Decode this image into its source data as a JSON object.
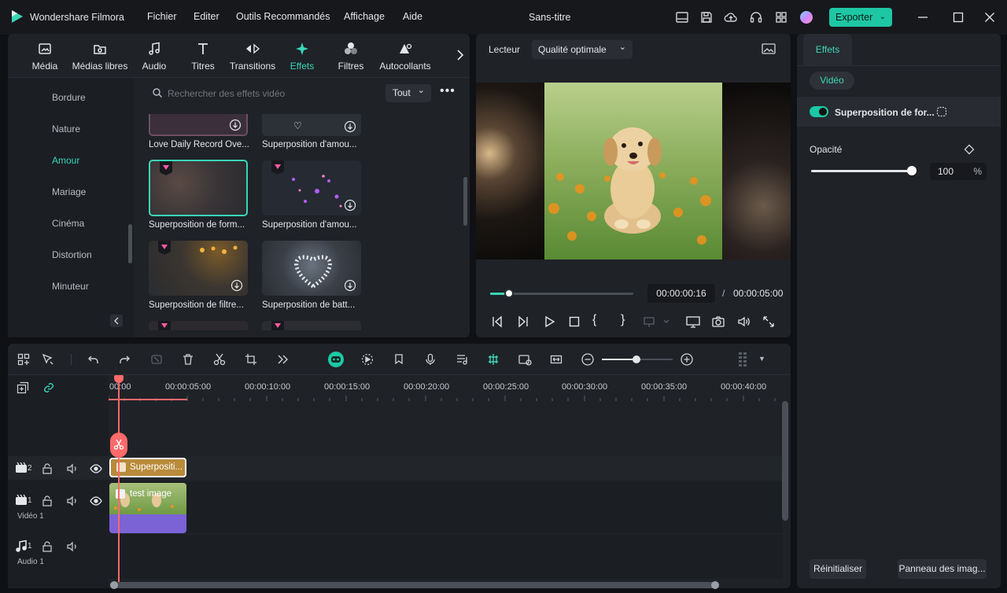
{
  "app": {
    "name": "Wondershare Filmora",
    "title": "Sans-titre",
    "export_label": "Exporter"
  },
  "menu": [
    "Fichier",
    "Editer",
    "Outils Recommandés",
    "Affichage",
    "Aide"
  ],
  "media_tabs": [
    {
      "label": "Média",
      "icon": "media-icon"
    },
    {
      "label": "Médias libres",
      "icon": "stock-media-icon"
    },
    {
      "label": "Audio",
      "icon": "music-note-icon"
    },
    {
      "label": "Titres",
      "icon": "text-t-icon"
    },
    {
      "label": "Transitions",
      "icon": "transition-icon"
    },
    {
      "label": "Effets",
      "icon": "sparkle-icon"
    },
    {
      "label": "Filtres",
      "icon": "filter-icon"
    },
    {
      "label": "Autocollants",
      "icon": "sticker-icon"
    }
  ],
  "categories": [
    "Bordure",
    "Nature",
    "Amour",
    "Mariage",
    "Cinéma",
    "Distortion",
    "Minuteur"
  ],
  "active_category": "Amour",
  "search": {
    "placeholder": "Rechercher des effets vidéo",
    "filter": "Tout"
  },
  "effects": [
    {
      "label": "Love Daily Record Ove..."
    },
    {
      "label": "Superposition d'amou..."
    },
    {
      "label": "Superposition de form..."
    },
    {
      "label": "Superposition d'amou..."
    },
    {
      "label": "Superposition de filtre..."
    },
    {
      "label": "Superposition de batt..."
    }
  ],
  "player": {
    "tab": "Lecteur",
    "quality": "Qualité optimale",
    "current_time": "00:00:00:16",
    "separator": "/",
    "total_time": "00:00:05:00",
    "progress": 0.13
  },
  "properties": {
    "tab": "Effets",
    "sub_tab": "Vidéo",
    "effect_name": "Superposition de for...",
    "opacity_label": "Opacité",
    "opacity_value": "100",
    "opacity_unit": "%",
    "opacity_fraction": 1.0,
    "reset_label": "Réinitialiser",
    "panel_label": "Panneau des imag..."
  },
  "timeline": {
    "ruler": [
      "00:00",
      "00:00:05:00",
      "00:00:10:00",
      "00:00:15:00",
      "00:00:20:00",
      "00:00:25:00",
      "00:00:30:00",
      "00:00:35:00",
      "00:00:40:00"
    ],
    "tracks": [
      {
        "num": "2",
        "name": ""
      },
      {
        "num": "1",
        "name": "Vidéo 1"
      },
      {
        "num": "1",
        "name": "Audio 1"
      }
    ],
    "clips": {
      "effect": "Superpositi...",
      "image": "test image"
    }
  }
}
